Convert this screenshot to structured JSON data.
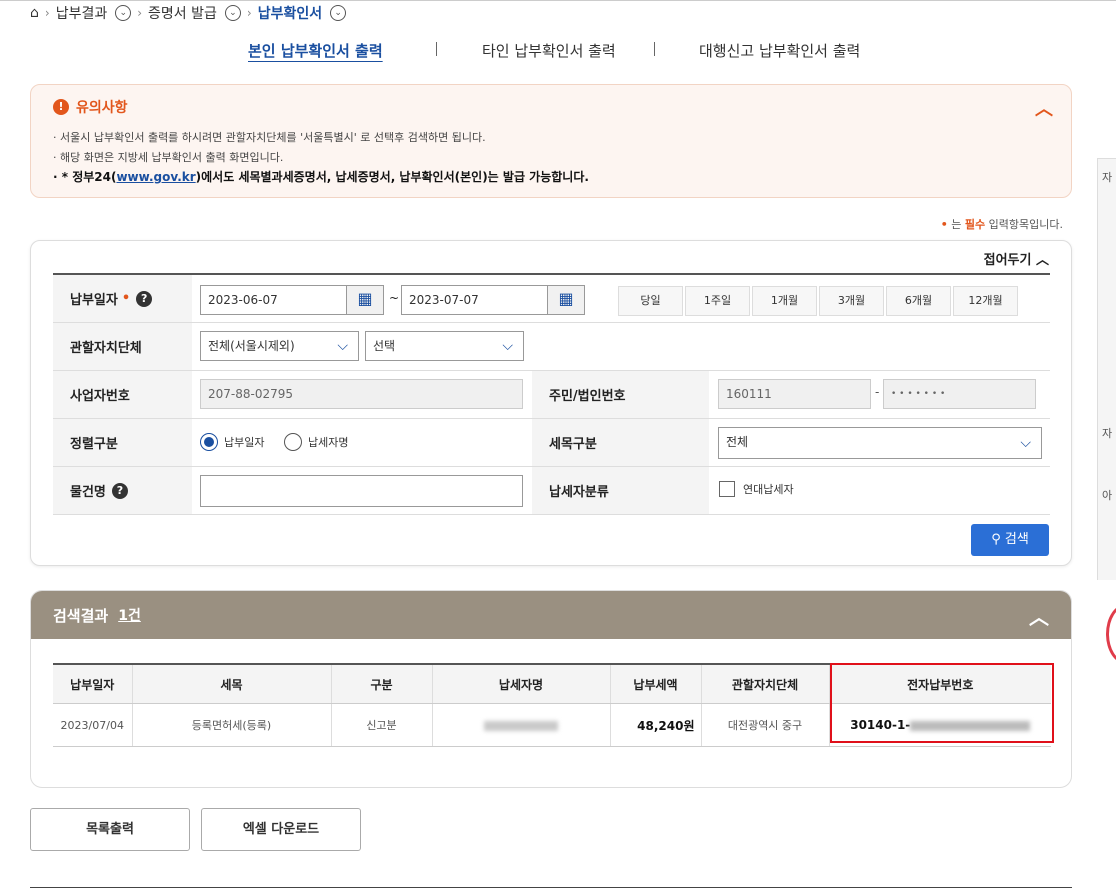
{
  "breadcrumb": {
    "home_icon": "home-icon",
    "items": [
      "납부결과",
      "증명서 발급",
      "납부확인서"
    ]
  },
  "tabs": [
    "본인 납부확인서 출력",
    "타인 납부확인서 출력",
    "대행신고 납부확인서 출력"
  ],
  "notice": {
    "title": "유의사항",
    "lines": [
      "· 서울시 납부확인서 출력를 하시려면 관할자치단체를 '서울특별시' 로 선택후 검색하면 됩니다.",
      "· 해당 화면은 지방세 납부확인서 출력 화면입니다."
    ],
    "bold_prefix": "· * 정부24(",
    "bold_link": "www.gov.kr",
    "bold_suffix": ")에서도 세목별과세증명서, 납세증명서, 납부확인서(본인)는 발급 가능합니다."
  },
  "required_note": {
    "dot": "•",
    "prefix": " 는 ",
    "em": "필수",
    "suffix": " 입력항목입니다."
  },
  "form": {
    "fold_label": "접어두기",
    "payment_date_label": "납부일자",
    "date_from": "2023-06-07",
    "date_tilde": "~",
    "date_to": "2023-07-07",
    "periods": [
      "당일",
      "1주일",
      "1개월",
      "3개월",
      "6개월",
      "12개월"
    ],
    "authority_label": "관할자치단체",
    "authority_select1": "전체(서울시제외)",
    "authority_select2": "선택",
    "biz_no_label": "사업자번호",
    "biz_no": "207-88-02795",
    "resident_no_label": "주민/법인번호",
    "resident_no_front": "160111",
    "resident_dash": "-",
    "resident_no_back": "• • • • • • •",
    "sort_label": "정렬구분",
    "sort_options": [
      "납부일자",
      "납세자명"
    ],
    "tax_item_label": "세목구분",
    "tax_item_value": "전체",
    "property_label": "물건명",
    "property_value": "",
    "taxpayer_class_label": "납세자분류",
    "joint_taxpayer_label": "연대납세자",
    "search_label": "검색"
  },
  "results": {
    "title": "검색결과",
    "count": "1건",
    "columns": [
      "납부일자",
      "세목",
      "구분",
      "납세자명",
      "납부세액",
      "관할자치단체",
      "전자납부번호"
    ],
    "rows": [
      {
        "date": "2023/07/04",
        "tax_item": "등록면허세(등록)",
        "type": "신고분",
        "amount": "48,240원",
        "authority": "대전광역시 중구",
        "epay_prefix": "30140-1-"
      }
    ]
  },
  "buttons": {
    "list_print": "목록출력",
    "excel_download": "엑셀 다운로드"
  },
  "side_panel": {
    "labels": [
      "자",
      "자",
      "아"
    ]
  },
  "colors": {
    "accent_blue": "#1a4fa0",
    "notice_orange": "#e2561c",
    "result_header": "#9a9081",
    "highlight_red": "#e0101a"
  }
}
